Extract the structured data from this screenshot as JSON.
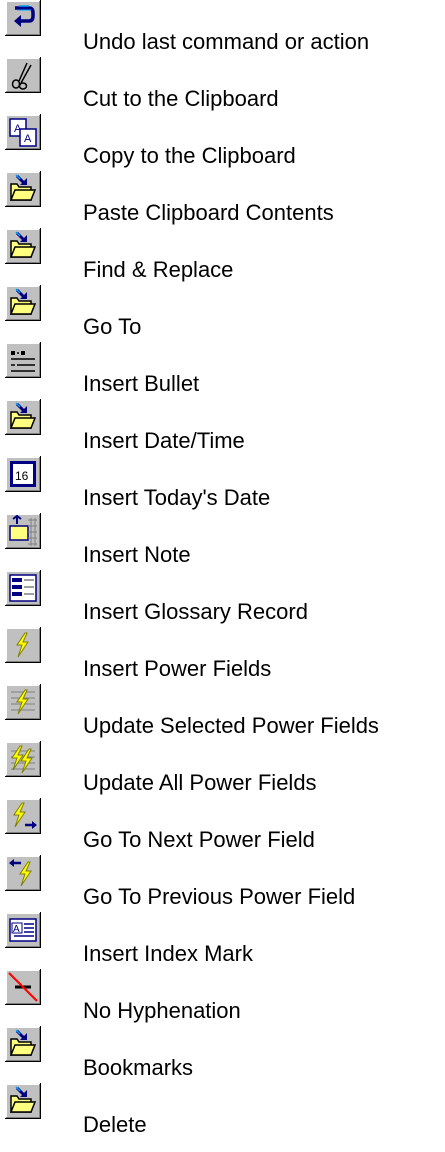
{
  "items": [
    {
      "label": "Undo last command or action",
      "icon": "undo-icon"
    },
    {
      "label": "Cut to the Clipboard",
      "icon": "scissors-icon"
    },
    {
      "label": "Copy to the Clipboard",
      "icon": "copy-icon"
    },
    {
      "label": "Paste Clipboard Contents",
      "icon": "folder-arrow-icon"
    },
    {
      "label": "Find & Replace",
      "icon": "folder-arrow-icon"
    },
    {
      "label": "Go To",
      "icon": "folder-arrow-icon"
    },
    {
      "label": "Insert Bullet",
      "icon": "bullet-list-icon"
    },
    {
      "label": "Insert Date/Time",
      "icon": "folder-arrow-icon"
    },
    {
      "label": "Insert Today's Date",
      "icon": "calendar-16-icon"
    },
    {
      "label": "Insert Note",
      "icon": "insert-note-icon"
    },
    {
      "label": "Insert Glossary Record",
      "icon": "glossary-record-icon"
    },
    {
      "label": "Insert Power Fields",
      "icon": "lightning-icon"
    },
    {
      "label": "Update Selected Power Fields",
      "icon": "lightning-page-icon"
    },
    {
      "label": "Update All Power Fields",
      "icon": "double-lightning-icon"
    },
    {
      "label": "Go To Next Power Field",
      "icon": "lightning-next-icon"
    },
    {
      "label": "Go To Previous Power Field",
      "icon": "lightning-previous-icon"
    },
    {
      "label": "Insert Index Mark",
      "icon": "index-mark-icon"
    },
    {
      "label": "No Hyphenation",
      "icon": "no-hyphen-icon"
    },
    {
      "label": "Bookmarks",
      "icon": "folder-arrow-icon"
    },
    {
      "label": "Delete",
      "icon": "folder-arrow-icon"
    }
  ],
  "colors": {
    "button_face": "#c0c0c0",
    "highlight": "#ffffff",
    "shadow": "#808080",
    "dark_shadow": "#000000",
    "navy": "#000080",
    "folder_yellow": "#ffff80",
    "bolt_yellow": "#ffff00",
    "red": "#ff0000"
  }
}
